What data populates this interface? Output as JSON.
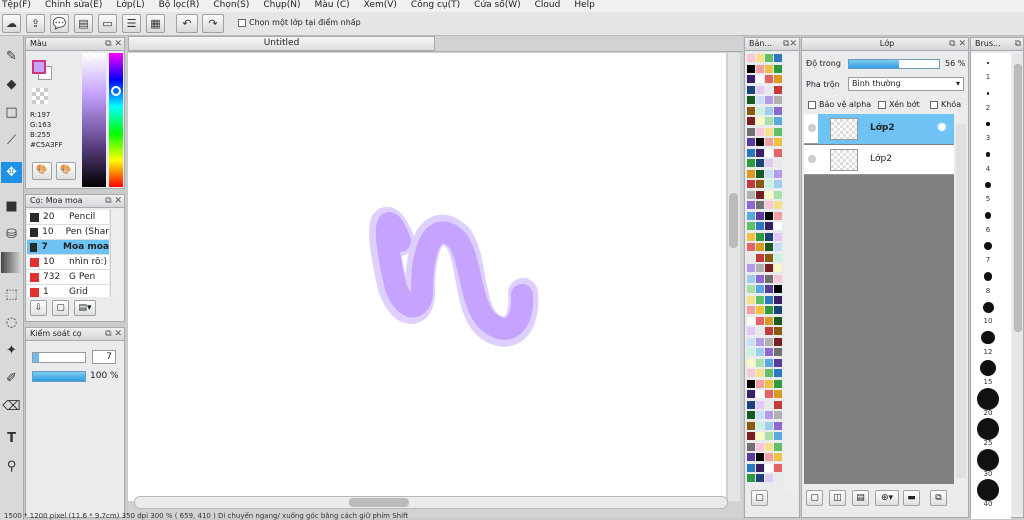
{
  "menu": [
    "Tệp(F)",
    "Chỉnh sửa(E)",
    "Lớp(L)",
    "Bộ lọc(R)",
    "Chọn(S)",
    "Chụp(N)",
    "Màu (C)",
    "Xem(V)",
    "Công cụ(T)",
    "Cửa sổ(W)",
    "Cloud",
    "Help"
  ],
  "toolbar": {
    "checkbox_label": "Chọn một lớp tại điểm nhấp"
  },
  "color_panel": {
    "title": "Màu",
    "r": "R:197",
    "g": "G:163",
    "b": "B:255",
    "hex": "#C5A3FF",
    "current_color": "#C5A3FF"
  },
  "brush_panel": {
    "title": "Cọ: Moa moa",
    "items": [
      {
        "size": "20",
        "name": "Pencil",
        "color": "#2a2a2a",
        "selected": false
      },
      {
        "size": "10",
        "name": "Pen (Shar",
        "color": "#2a2a2a",
        "selected": false
      },
      {
        "size": "7",
        "name": "Moa moa",
        "color": "#2a2a2a",
        "selected": true
      },
      {
        "size": "10",
        "name": "nhìn rõ:)",
        "color": "#e03030",
        "selected": false
      },
      {
        "size": "732",
        "name": "G Pen",
        "color": "#e03030",
        "selected": false
      },
      {
        "size": "1",
        "name": "Grid",
        "color": "#e03030",
        "selected": false
      }
    ]
  },
  "brush_control": {
    "title": "Kiểm soát cọ",
    "size": "7",
    "opacity": "100 %"
  },
  "canvas": {
    "tab_title": "Untitled",
    "stroke_color": "#C5A3FF"
  },
  "palette_panel": {
    "title": "Bản..."
  },
  "layer_panel": {
    "title": "Lớp",
    "opacity_label": "Độ trong",
    "opacity_value": "56 %",
    "opacity_fraction": 0.56,
    "blend_label": "Pha trộn",
    "blend_value": "Bình thường",
    "protect_alpha": "Bảo vệ alpha",
    "clip": "Xén bớt",
    "lock": "Khóa",
    "layers": [
      {
        "name": "Lớp2",
        "selected": true
      },
      {
        "name": "Lớp2",
        "selected": false
      }
    ]
  },
  "brush_size_panel": {
    "title": "Brus...",
    "sizes": [
      "1",
      "2",
      "3",
      "4",
      "5",
      "6",
      "7",
      "8",
      "10",
      "12",
      "15",
      "20",
      "25",
      "30",
      "40"
    ]
  },
  "status": {
    "text": "1500 * 1200 pixel  (11.6 * 9.7cm)  350 dpi  300 %  ( 659, 410 )  Di chuyển ngang/ xuống góc bằng cách giữ phím Shift"
  }
}
